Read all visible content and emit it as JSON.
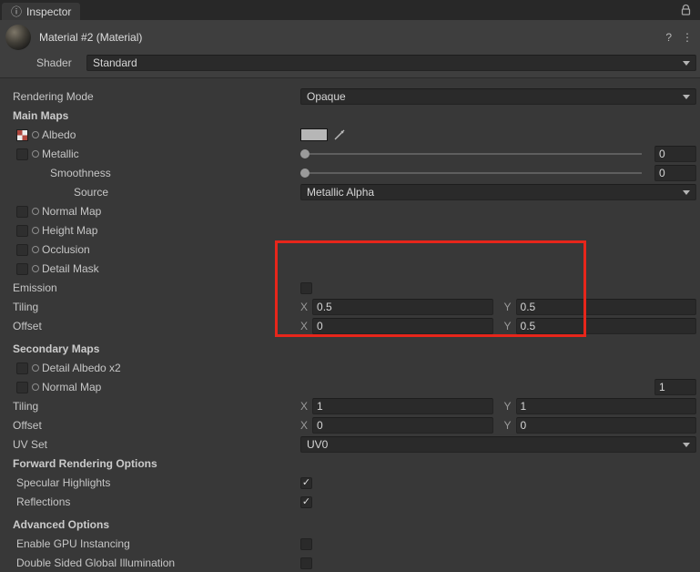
{
  "tabbar": {
    "tab": "Inspector"
  },
  "header": {
    "title": "Material #2 (Material)",
    "shader_label": "Shader",
    "shader_value": "Standard"
  },
  "icons": {
    "check": "✓",
    "help": "?",
    "kebab": "⋮",
    "info": "ⓘ"
  },
  "fields": {
    "rendering_mode": {
      "label": "Rendering Mode",
      "value": "Opaque"
    },
    "main_maps": {
      "label": "Main Maps"
    },
    "albedo": {
      "label": "Albedo"
    },
    "metallic": {
      "label": "Metallic",
      "value": "0"
    },
    "smoothness": {
      "label": "Smoothness",
      "value": "0"
    },
    "source": {
      "label": "Source",
      "value": "Metallic Alpha"
    },
    "normal_map": {
      "label": "Normal Map"
    },
    "height_map": {
      "label": "Height Map"
    },
    "occlusion": {
      "label": "Occlusion"
    },
    "detail_mask": {
      "label": "Detail Mask"
    },
    "emission": {
      "label": "Emission"
    },
    "tiling_main": {
      "label": "Tiling",
      "x_label": "X",
      "x": "0.5",
      "y_label": "Y",
      "y": "0.5"
    },
    "offset_main": {
      "label": "Offset",
      "x_label": "X",
      "x": "0",
      "y_label": "Y",
      "y": "0.5"
    },
    "secondary_maps": {
      "label": "Secondary Maps"
    },
    "detail_albedo": {
      "label": "Detail Albedo x2"
    },
    "normal_map_secondary": {
      "label": "Normal Map",
      "value": "1"
    },
    "tiling_secondary": {
      "label": "Tiling",
      "x_label": "X",
      "x": "1",
      "y_label": "Y",
      "y": "1"
    },
    "offset_secondary": {
      "label": "Offset",
      "x_label": "X",
      "x": "0",
      "y_label": "Y",
      "y": "0"
    },
    "uv_set": {
      "label": "UV Set",
      "value": "UV0"
    },
    "forward_rendering_options": {
      "label": "Forward Rendering Options"
    },
    "specular_highlights": {
      "label": "Specular Highlights",
      "checked": true
    },
    "reflections": {
      "label": "Reflections",
      "checked": true
    },
    "advanced_options": {
      "label": "Advanced Options"
    },
    "gpu_instancing": {
      "label": "Enable GPU Instancing"
    },
    "double_sided_gi": {
      "label": "Double Sided Global Illumination"
    }
  },
  "annotation": {
    "color": "#e7261b"
  },
  "colors": {
    "background": "#383838",
    "tabbar": "#282828",
    "field": "#2a2a2a",
    "accent_annotation": "#e7261b"
  }
}
